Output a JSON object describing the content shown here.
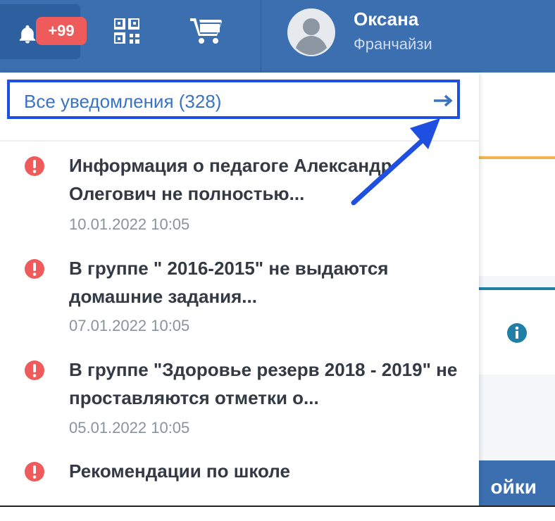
{
  "header": {
    "badge_count": "+99",
    "user": {
      "name": "Оксана",
      "role": "Франчайзи"
    }
  },
  "notifications": {
    "all_link_label": "Все уведомления (328)",
    "items": [
      {
        "title": "Информация о педагоге Александр Олегович            не полностью...",
        "date": "10.01.2022 10:05",
        "icon": "exclamation-circle-icon"
      },
      {
        "title": "В группе \"            2016-2015\" не выдаются домашние задания...",
        "date": "07.01.2022 10:05",
        "icon": "exclamation-circle-icon"
      },
      {
        "title": "В группе \"Здоровье резерв 2018 - 2019\" не проставляются отметки о...",
        "date": "05.01.2022 10:05",
        "icon": "exclamation-circle-icon"
      },
      {
        "title": "Рекомендации по школе",
        "date": "",
        "icon": "exclamation-circle-icon"
      }
    ]
  },
  "background": {
    "settings_button_label": "ойки"
  },
  "colors": {
    "header": "#3b6fb0",
    "badge": "#ef5a5a",
    "alert_icon": "#ef5a5a",
    "link": "#3b73c4",
    "highlight": "#1f4fe0"
  }
}
